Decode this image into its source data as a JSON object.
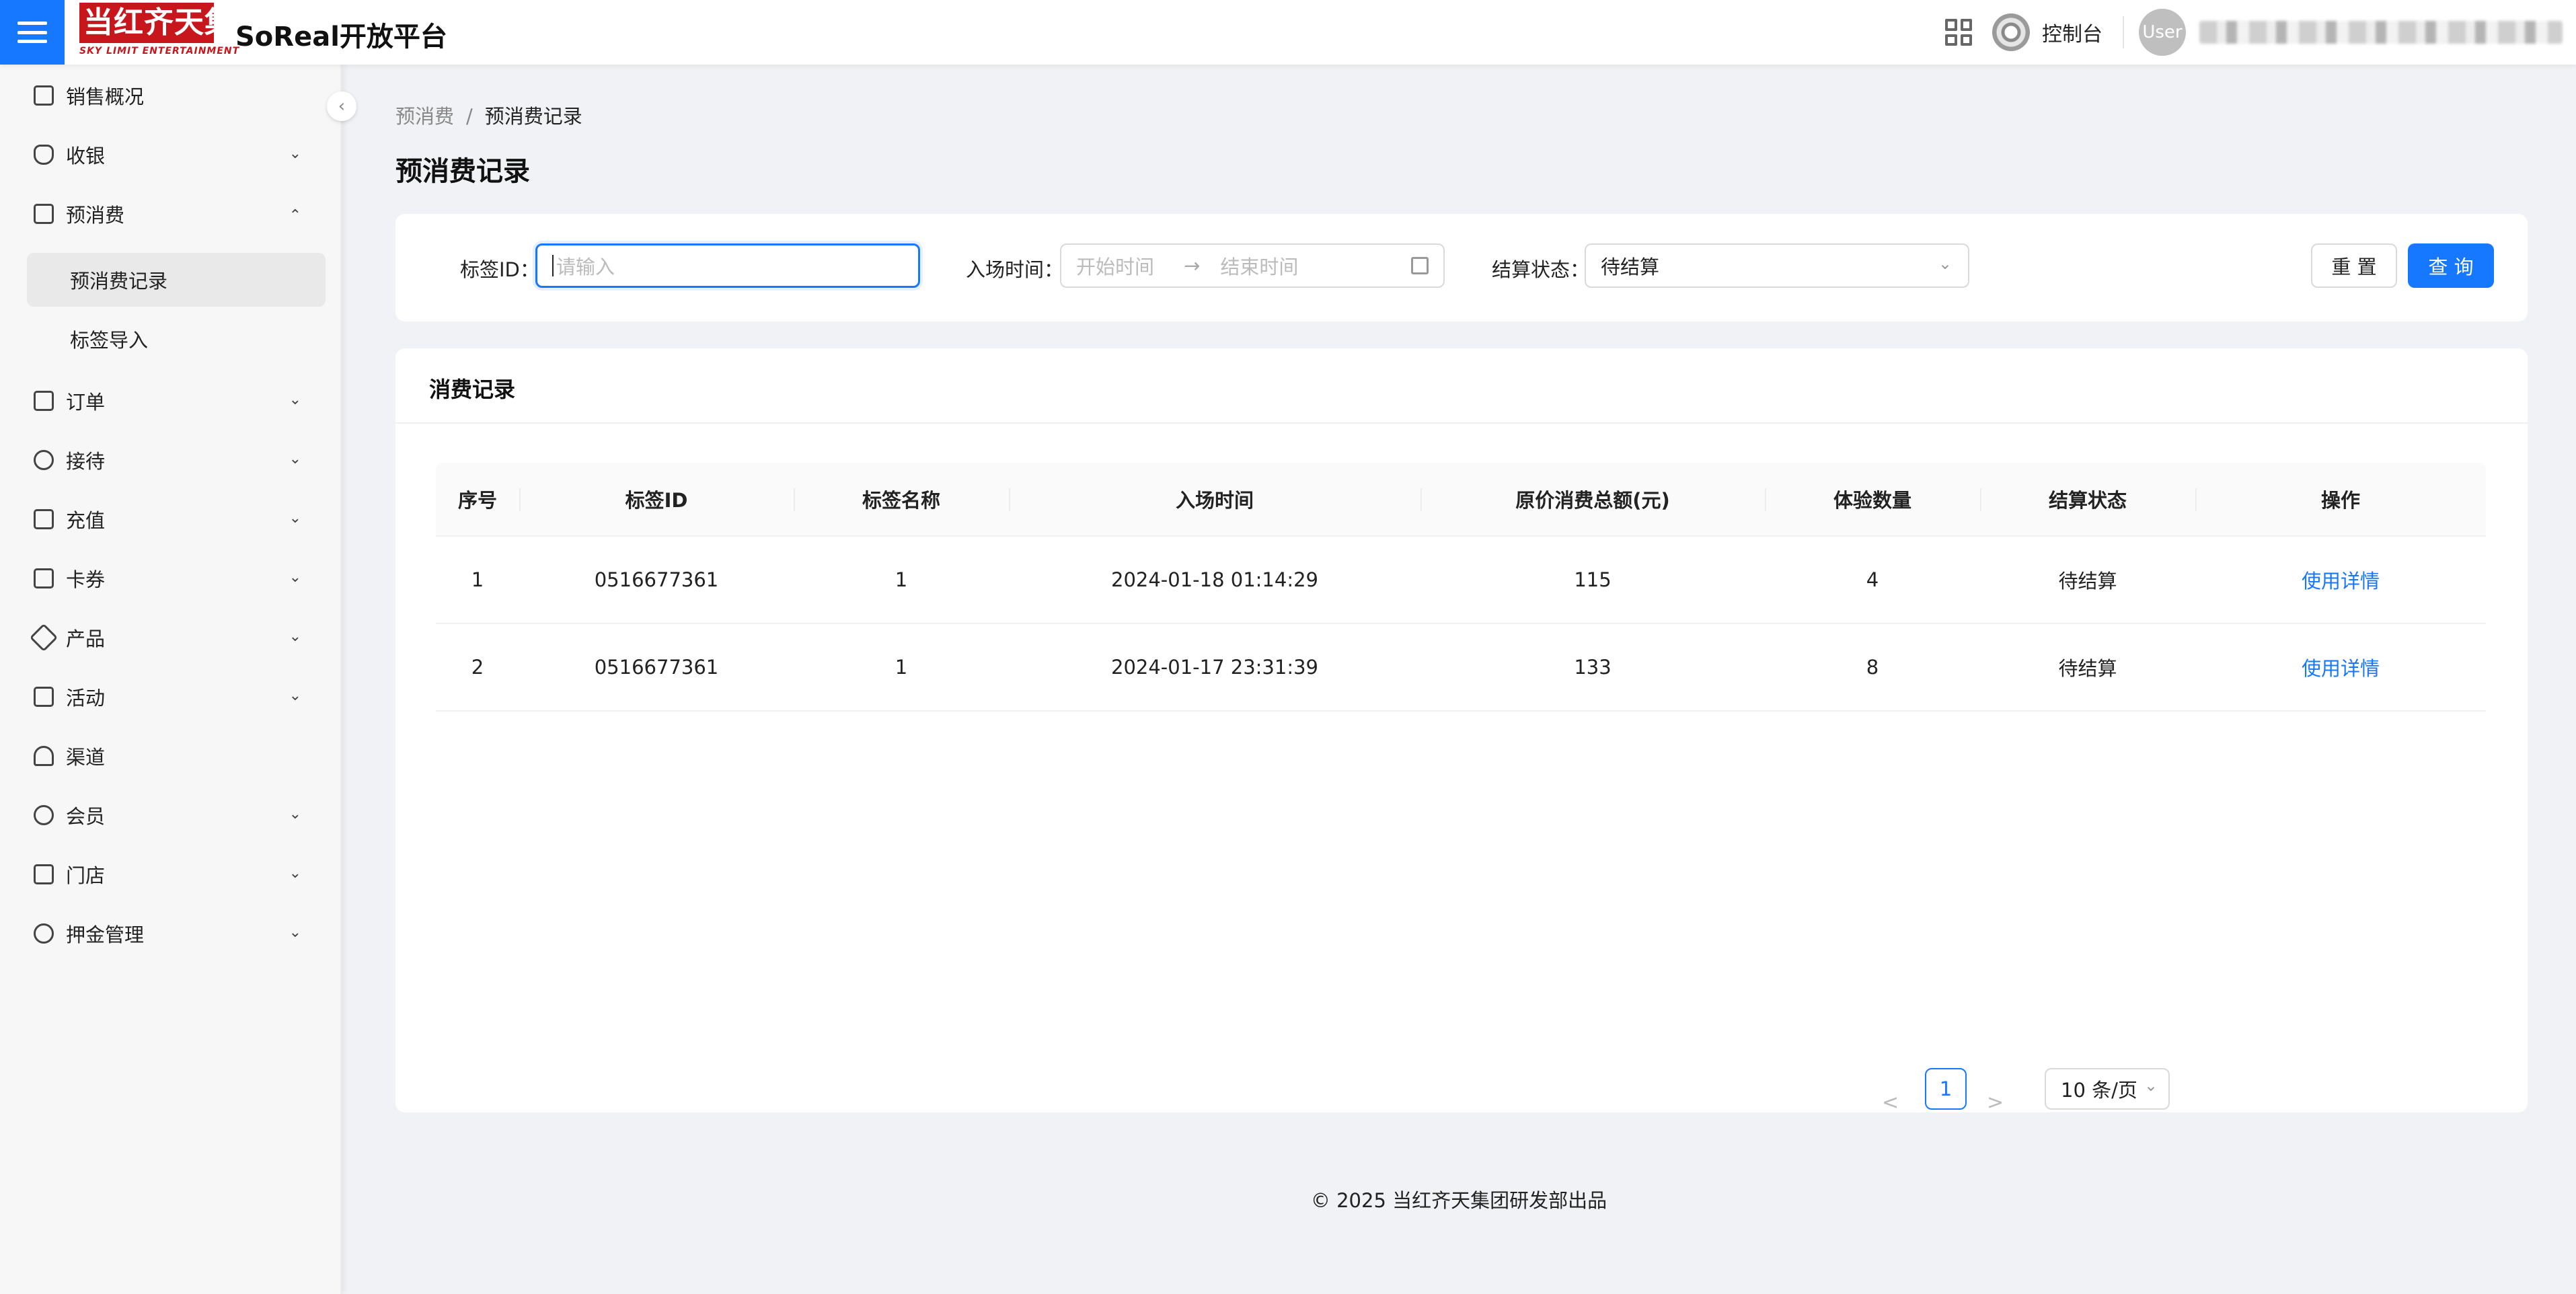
{
  "header": {
    "logo_text": "当红齐天集团",
    "logo_sub": "SKY LIMIT ENTERTAINMENT",
    "app_title": "SoReal开放平台",
    "console_label": "控制台",
    "avatar_text": "User"
  },
  "sidebar": {
    "items": [
      {
        "label": "销售概况",
        "icon": "chart-icon"
      },
      {
        "label": "收银",
        "icon": "shield-icon"
      },
      {
        "label": "预消费",
        "icon": "folder-icon"
      },
      {
        "label": "订单",
        "icon": "file-icon"
      },
      {
        "label": "接待",
        "icon": "user-icon"
      },
      {
        "label": "充值",
        "icon": "recharge-icon"
      },
      {
        "label": "卡券",
        "icon": "card-icon"
      },
      {
        "label": "产品",
        "icon": "product-icon"
      },
      {
        "label": "活动",
        "icon": "activity-icon"
      },
      {
        "label": "渠道",
        "icon": "channel-icon"
      },
      {
        "label": "会员",
        "icon": "member-icon"
      },
      {
        "label": "门店",
        "icon": "store-icon"
      },
      {
        "label": "押金管理",
        "icon": "deposit-icon"
      }
    ],
    "sub_items": [
      {
        "label": "预消费记录"
      },
      {
        "label": "标签导入"
      }
    ]
  },
  "breadcrumb": {
    "parent": "预消费",
    "current": "预消费记录"
  },
  "page_title": "预消费记录",
  "filters": {
    "tag_id_label": "标签ID：",
    "tag_id_placeholder": "请输入",
    "entry_time_label": "入场时间：",
    "start_placeholder": "开始时间",
    "end_placeholder": "结束时间",
    "status_label": "结算状态：",
    "status_value": "待结算",
    "reset_label": "重 置",
    "query_label": "查 询"
  },
  "table": {
    "title": "消费记录",
    "columns": [
      "序号",
      "标签ID",
      "标签名称",
      "入场时间",
      "原价消费总额(元)",
      "体验数量",
      "结算状态",
      "操作"
    ],
    "rows": [
      {
        "index": "1",
        "tag_id": "0516677361",
        "tag_name": "1",
        "entry_time": "2024-01-18 01:14:29",
        "amount": "115",
        "quantity": "4",
        "status": "待结算",
        "action": "使用详情"
      },
      {
        "index": "2",
        "tag_id": "0516677361",
        "tag_name": "1",
        "entry_time": "2024-01-17 23:31:39",
        "amount": "133",
        "quantity": "8",
        "status": "待结算",
        "action": "使用详情"
      }
    ]
  },
  "pagination": {
    "current_page": "1",
    "page_size": "10 条/页",
    "prev": "<",
    "next": ">"
  },
  "footer": {
    "copyright": "© 2025 当红齐天集团研发部出品"
  }
}
